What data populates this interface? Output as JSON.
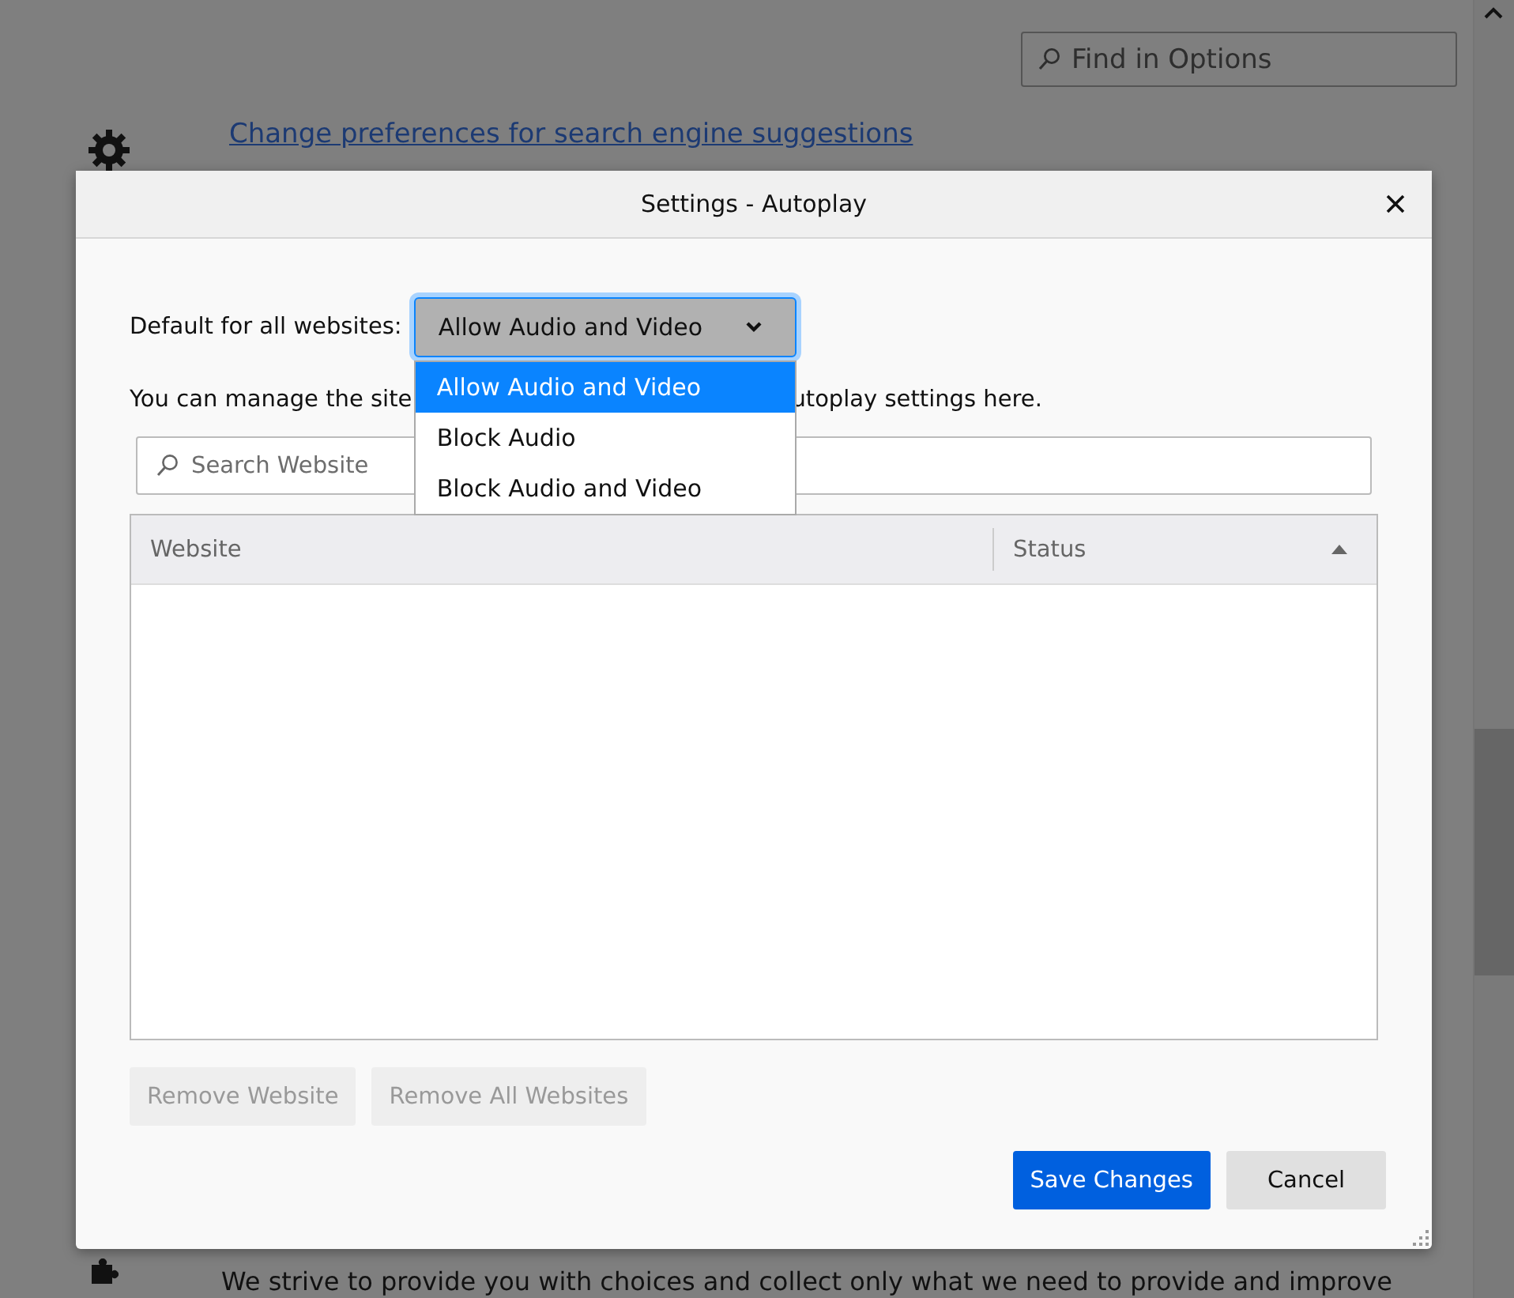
{
  "page": {
    "search": {
      "placeholder": "Find in Options"
    },
    "link": "Change preferences for search engine suggestions",
    "footer_text": "We strive to provide you with choices and collect only what we need to provide and improve"
  },
  "dialog": {
    "title": "Settings - Autoplay",
    "default_label": "Default for all websites:",
    "default_value": "Allow Audio and Video",
    "dropdown": {
      "expanded": true,
      "options": [
        {
          "label": "Allow Audio and Video",
          "selected": true
        },
        {
          "label": "Block Audio",
          "selected": false
        },
        {
          "label": "Block Audio and Video",
          "selected": false
        }
      ]
    },
    "description_start": "You can manage the site",
    "description_end": "utoplay settings here.",
    "search": {
      "placeholder": "Search Website"
    },
    "table": {
      "columns": [
        {
          "label": "Website",
          "sorted": false
        },
        {
          "label": "Status",
          "sorted": true
        }
      ]
    },
    "buttons": [
      {
        "label": "Remove Website",
        "disabled": true,
        "primary": false
      },
      {
        "label": "Remove All Websites",
        "disabled": true,
        "primary": false
      }
    ],
    "footer_buttons": [
      {
        "label": "Save Changes",
        "disabled": false,
        "primary": true
      },
      {
        "label": "Cancel",
        "disabled": false,
        "primary": false
      }
    ]
  }
}
